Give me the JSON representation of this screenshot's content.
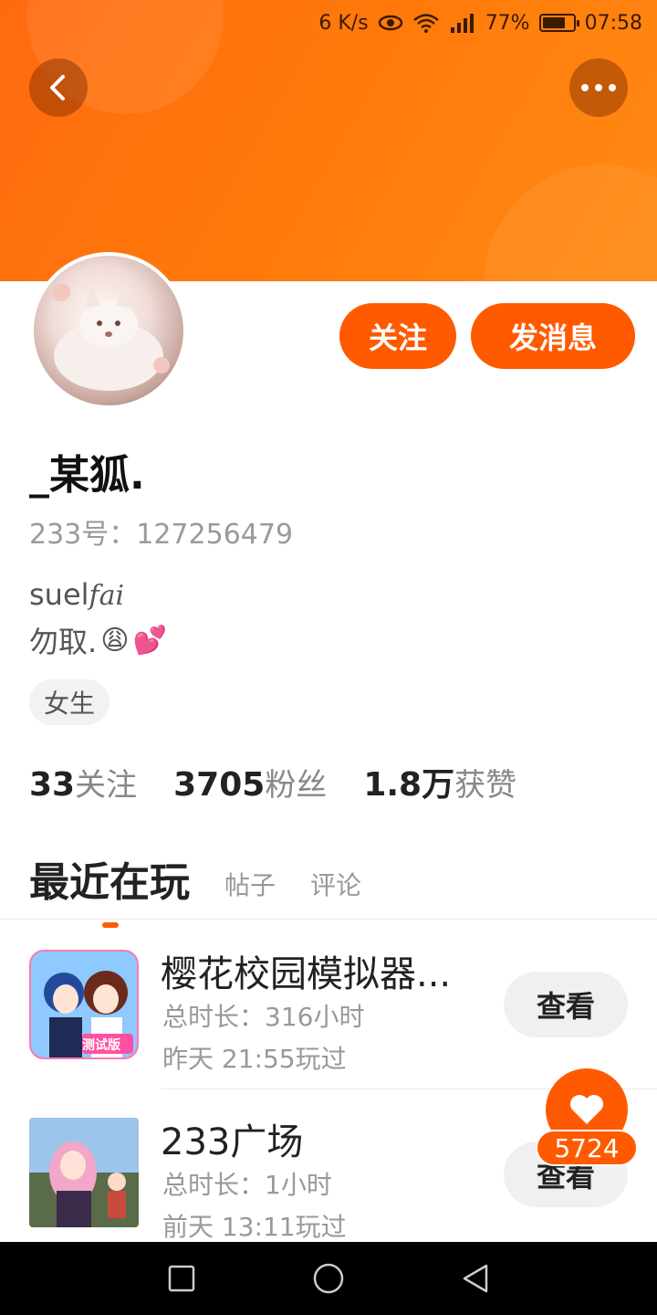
{
  "status_bar": {
    "net_speed": "6 K/s",
    "battery": "77%",
    "battery_level": 0.77,
    "time": "07:58",
    "icons": [
      "eye-icon",
      "wifi-icon",
      "signal-icon",
      "battery-icon"
    ]
  },
  "header": {
    "back_icon": "chevron-left-icon",
    "more_icon": "more-dots-icon"
  },
  "profile": {
    "nickname": "_某狐.",
    "user_id": "233号：127256479",
    "bio_line1_text": "suel",
    "bio_line1_script": "fai",
    "bio_line2_text": "勿取.",
    "bio_emojis": [
      "😩",
      "💕"
    ],
    "gender": "女生",
    "follow_label": "关注",
    "message_label": "发消息",
    "accent_color": "#ff5a00"
  },
  "stats": {
    "following_count": "33",
    "following_label": "关注",
    "fans_count": "3705",
    "fans_label": "粉丝",
    "likes_count": "1.8万",
    "likes_label": "获赞"
  },
  "tabs": {
    "active": "最近在玩",
    "posts": "帖子",
    "comments": "评论"
  },
  "games": [
    {
      "title": "樱花校园模拟器...",
      "duration": "总时长：316小时",
      "last_played": "昨天 21:55玩过",
      "button": "查看",
      "badge": "测试版"
    },
    {
      "title": "233广场",
      "duration": "总时长：1小时",
      "last_played": "前天 13:11玩过",
      "button": "查看"
    }
  ],
  "like_fab": {
    "count": "5724"
  }
}
